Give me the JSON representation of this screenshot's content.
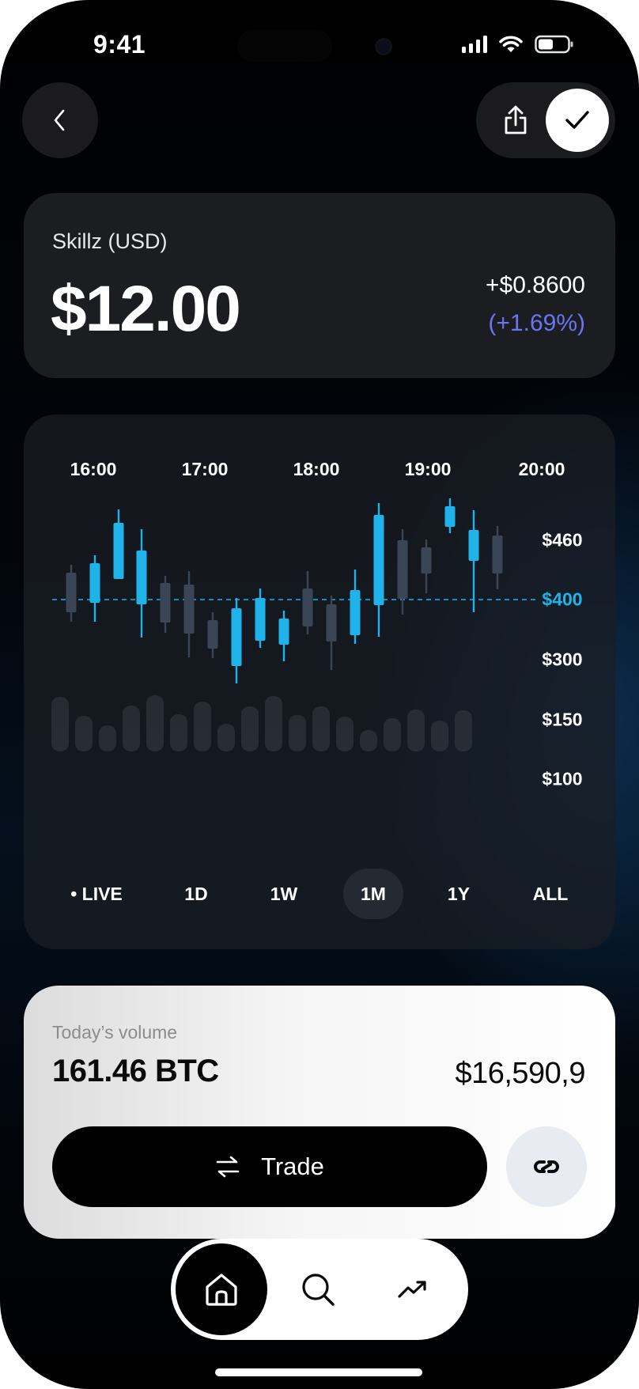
{
  "status_bar": {
    "time": "9:41"
  },
  "asset": {
    "pair": "Skillz (USD)",
    "price": "$12.00",
    "change_abs": "+$0.8600",
    "change_pct": "(+1.69%)"
  },
  "chart": {
    "time_labels": [
      "16:00",
      "17:00",
      "18:00",
      "19:00",
      "20:00"
    ],
    "price_labels": [
      "$460",
      "$400",
      "$300",
      "$150",
      "$100"
    ],
    "reference_label": "$400",
    "ranges": [
      "• LIVE",
      "1D",
      "1W",
      "1M",
      "1Y",
      "ALL"
    ],
    "active_range": "1M"
  },
  "volume": {
    "label": "Today’s volume",
    "btc": "161.46 BTC",
    "usd": "$16,590,9"
  },
  "actions": {
    "trade_label": "Trade"
  },
  "tabs": [
    "home-icon",
    "search-icon",
    "trending-icon"
  ],
  "colors": {
    "accent_blue": "#1fb3ea",
    "muted_candle": "#3a4656",
    "change_pct": "#6c74f2"
  }
}
